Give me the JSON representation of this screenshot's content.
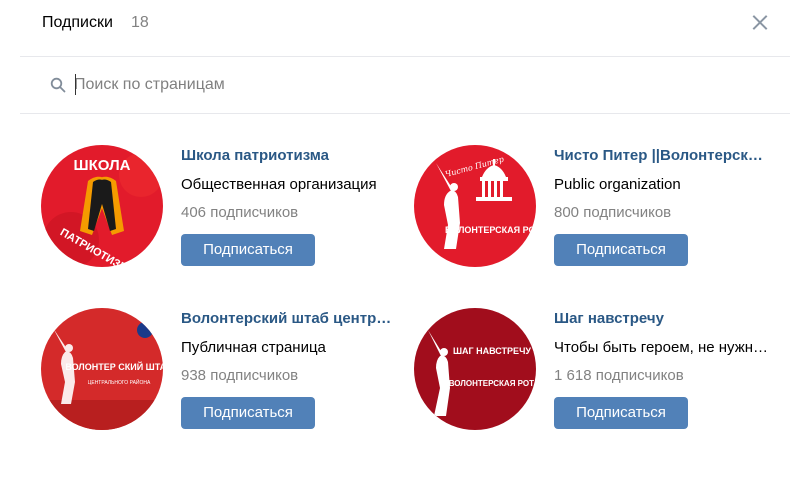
{
  "header": {
    "title": "Подписки",
    "count": "18"
  },
  "search": {
    "placeholder": "Поиск по страницам",
    "value": ""
  },
  "colors": {
    "link": "#2a5885",
    "button": "#5181b8",
    "muted": "#828282",
    "avatar_red": "#e21b2b",
    "avatar_dark_red": "#a10d1c"
  },
  "cards": [
    {
      "name": "Школа патриотизма",
      "description": "Общественная организация",
      "subscribers": "406 подписчиков",
      "button": "Подписаться",
      "avatar": {
        "icon": "st-george-ribbon-icon",
        "top_text": "ШКОЛА",
        "bottom_text": "ПАТРИОТИЗМА"
      }
    },
    {
      "name": "Чисто Питер ||Волонтерская Рота",
      "description": "Public organization",
      "subscribers": "800 подписчиков",
      "button": "Подписаться",
      "avatar": {
        "icon": "motherland-statue-icon",
        "top_text": "Чисто Питер",
        "bottom_text": "ВОЛОНТЕРСКАЯ РОТА"
      }
    },
    {
      "name": "Волонтерский штаб центрального района",
      "description": "Публичная страница",
      "subscribers": "938 подписчиков",
      "button": "Подписаться",
      "avatar": {
        "icon": "motherland-statue-icon",
        "top_text": "ВОЛОНТЕР СКИЙ ШТАБ",
        "bottom_text": "ЦЕНТРАЛЬНОГО РАЙОНА"
      }
    },
    {
      "name": "Шаг навстречу",
      "description": "Чтобы быть героем, не нужно...",
      "subscribers": "1 618 подписчиков",
      "button": "Подписаться",
      "avatar": {
        "icon": "motherland-statue-icon",
        "top_text": "ШАГ НАВСТРЕЧУ",
        "bottom_text": "ВОЛОНТЕРСКАЯ РОТА"
      }
    }
  ]
}
